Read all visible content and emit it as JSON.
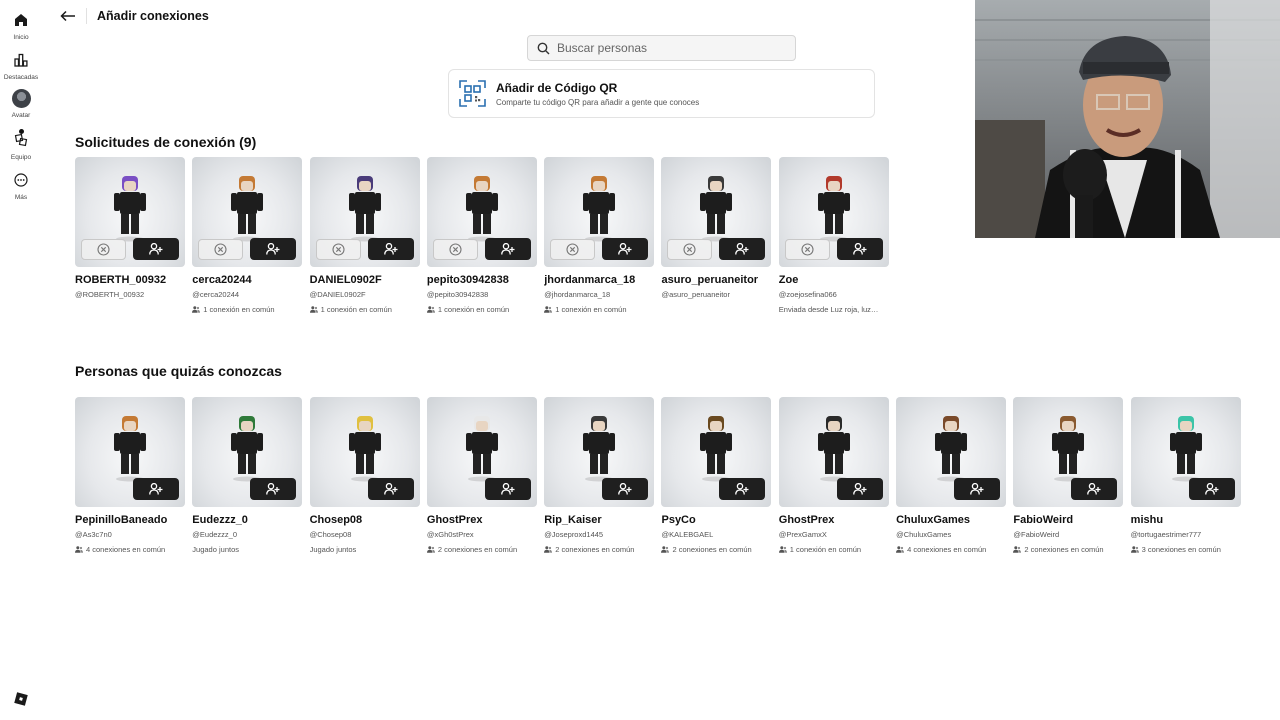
{
  "nav": {
    "items": [
      {
        "label": "Inicio",
        "icon": "home-icon"
      },
      {
        "label": "Destacadas",
        "icon": "charts-icon"
      },
      {
        "label": "Avatar",
        "icon": "avatar-icon"
      },
      {
        "label": "Equipo",
        "icon": "party-icon"
      },
      {
        "label": "Más",
        "icon": "more-icon"
      }
    ]
  },
  "header": {
    "title": "Añadir conexiones"
  },
  "search": {
    "placeholder": "Buscar personas"
  },
  "qr": {
    "title": "Añadir de Código QR",
    "subtitle": "Comparte tu código QR para añadir a gente que conoces"
  },
  "requests": {
    "title": "Solicitudes de conexión (9)",
    "items": [
      {
        "name": "ROBERTH_00932",
        "handle": "@ROBERTH_00932",
        "meta": "",
        "color": "#7a4fc4"
      },
      {
        "name": "cerca20244",
        "handle": "@cerca20244",
        "meta": "1 conexión en común",
        "color": "#c47a35"
      },
      {
        "name": "DANIEL0902F",
        "handle": "@DANIEL0902F",
        "meta": "1 conexión en común",
        "color": "#4a3c7a"
      },
      {
        "name": "pepito30942838",
        "handle": "@pepito30942838",
        "meta": "1 conexión en común",
        "color": "#c47a35"
      },
      {
        "name": "jhordanmarca_18",
        "handle": "@jhordanmarca_18",
        "meta": "1 conexión en común",
        "color": "#c47a35"
      },
      {
        "name": "asuro_peruaneitor",
        "handle": "@asuro_peruaneitor",
        "meta": "",
        "color": "#3a3a3a"
      },
      {
        "name": "Zoe",
        "handle": "@zoejosefina066",
        "meta": "Enviada desde Luz roja, luz…",
        "color": "#b23a2c"
      }
    ]
  },
  "suggestions": {
    "title": "Personas que quizás conozcas",
    "items": [
      {
        "name": "PepinilloBaneado",
        "handle": "@As3c7n0",
        "meta": "4 conexiones en común",
        "color": "#c47a35"
      },
      {
        "name": "Eudezzz_0",
        "handle": "@Eudezzz_0",
        "meta": "Jugado juntos",
        "color": "#2f7a3a"
      },
      {
        "name": "Chosep08",
        "handle": "@Chosep08",
        "meta": "Jugado juntos",
        "color": "#e0c040"
      },
      {
        "name": "GhostPrex",
        "handle": "@xGh0stPrex",
        "meta": "2 conexiones en común",
        "color": "#e8e8e8"
      },
      {
        "name": "Rip_Kaiser",
        "handle": "@Joseproxd1445",
        "meta": "2 conexiones en común",
        "color": "#3a3a3a"
      },
      {
        "name": "PsyCo",
        "handle": "@KALEBGAEL",
        "meta": "2 conexiones en común",
        "color": "#6a4a20"
      },
      {
        "name": "GhostPrex",
        "handle": "@PrexGamxX",
        "meta": "1 conexión en común",
        "color": "#2a2a2a"
      },
      {
        "name": "ChuluxGames",
        "handle": "@ChuluxGames",
        "meta": "4 conexiones en común",
        "color": "#7a4a2a"
      },
      {
        "name": "FabioWeird",
        "handle": "@FabioWeird",
        "meta": "2 conexiones en común",
        "color": "#8a5a30"
      },
      {
        "name": "mishu",
        "handle": "@tortugaestrimer777",
        "meta": "3 conexiones en común",
        "color": "#3bc4a8"
      }
    ]
  }
}
